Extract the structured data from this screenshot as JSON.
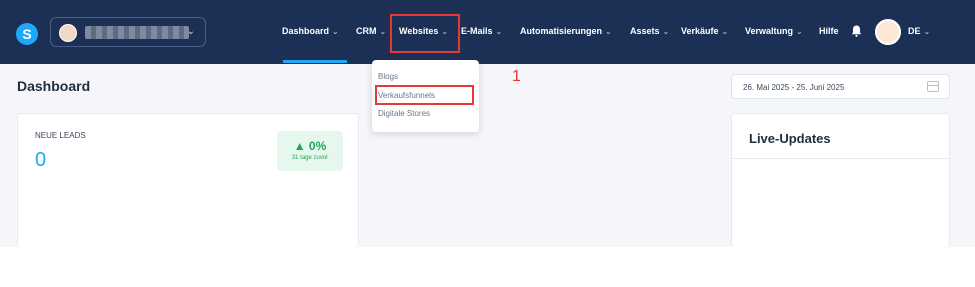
{
  "brand": {
    "logo_letter": "S",
    "color": "#1ea8f7"
  },
  "account": {
    "name": "",
    "chevron": "chevron-down-icon"
  },
  "nav": {
    "items": [
      {
        "label": "Dashboard",
        "caret": "⌄"
      },
      {
        "label": "CRM",
        "caret": "⌄"
      },
      {
        "label": "Websites",
        "caret": "⌄"
      },
      {
        "label": "E-Mails",
        "caret": "⌄"
      },
      {
        "label": "Automatisierungen",
        "caret": "⌄"
      },
      {
        "label": "Assets",
        "caret": "⌄"
      },
      {
        "label": "Verkäufe",
        "caret": "⌄"
      },
      {
        "label": "Verwaltung",
        "caret": "⌄"
      },
      {
        "label": "Hilfe",
        "caret": ""
      }
    ],
    "language": "DE",
    "language_caret": "⌄"
  },
  "dropdown": {
    "items": [
      "Blogs",
      "Verkaufsfunnels",
      "Digitale Stores"
    ]
  },
  "annotation": "1",
  "page": {
    "title": "Dashboard",
    "date_range": "26. Mai 2025 - 25. Juni 2025"
  },
  "leads": {
    "label": "NEUE LEADS",
    "value": "0",
    "trend_value": "▲ 0%",
    "trend_sub": "31 tage zuvor"
  },
  "live": {
    "title": "Live-Updates"
  },
  "colors": {
    "topbar": "#1c2f55",
    "accent": "#1ea8f7",
    "highlight": "#e53935",
    "positive": "#23a65a"
  }
}
